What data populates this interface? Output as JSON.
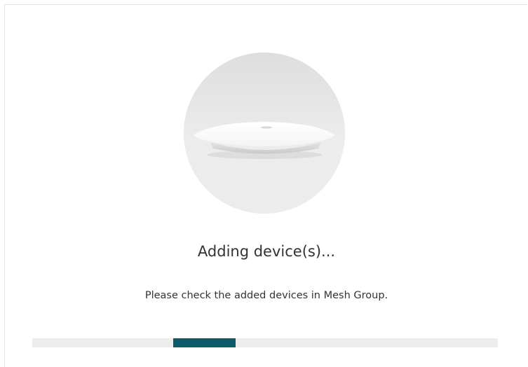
{
  "dialog": {
    "device_image": "ceiling-mount-access-point",
    "heading": "Adding device(s)...",
    "message": "Please check the added devices in Mesh Group."
  },
  "progress": {
    "state": "indeterminate",
    "color": "#0b5a6a",
    "track_color": "#eceeee"
  }
}
